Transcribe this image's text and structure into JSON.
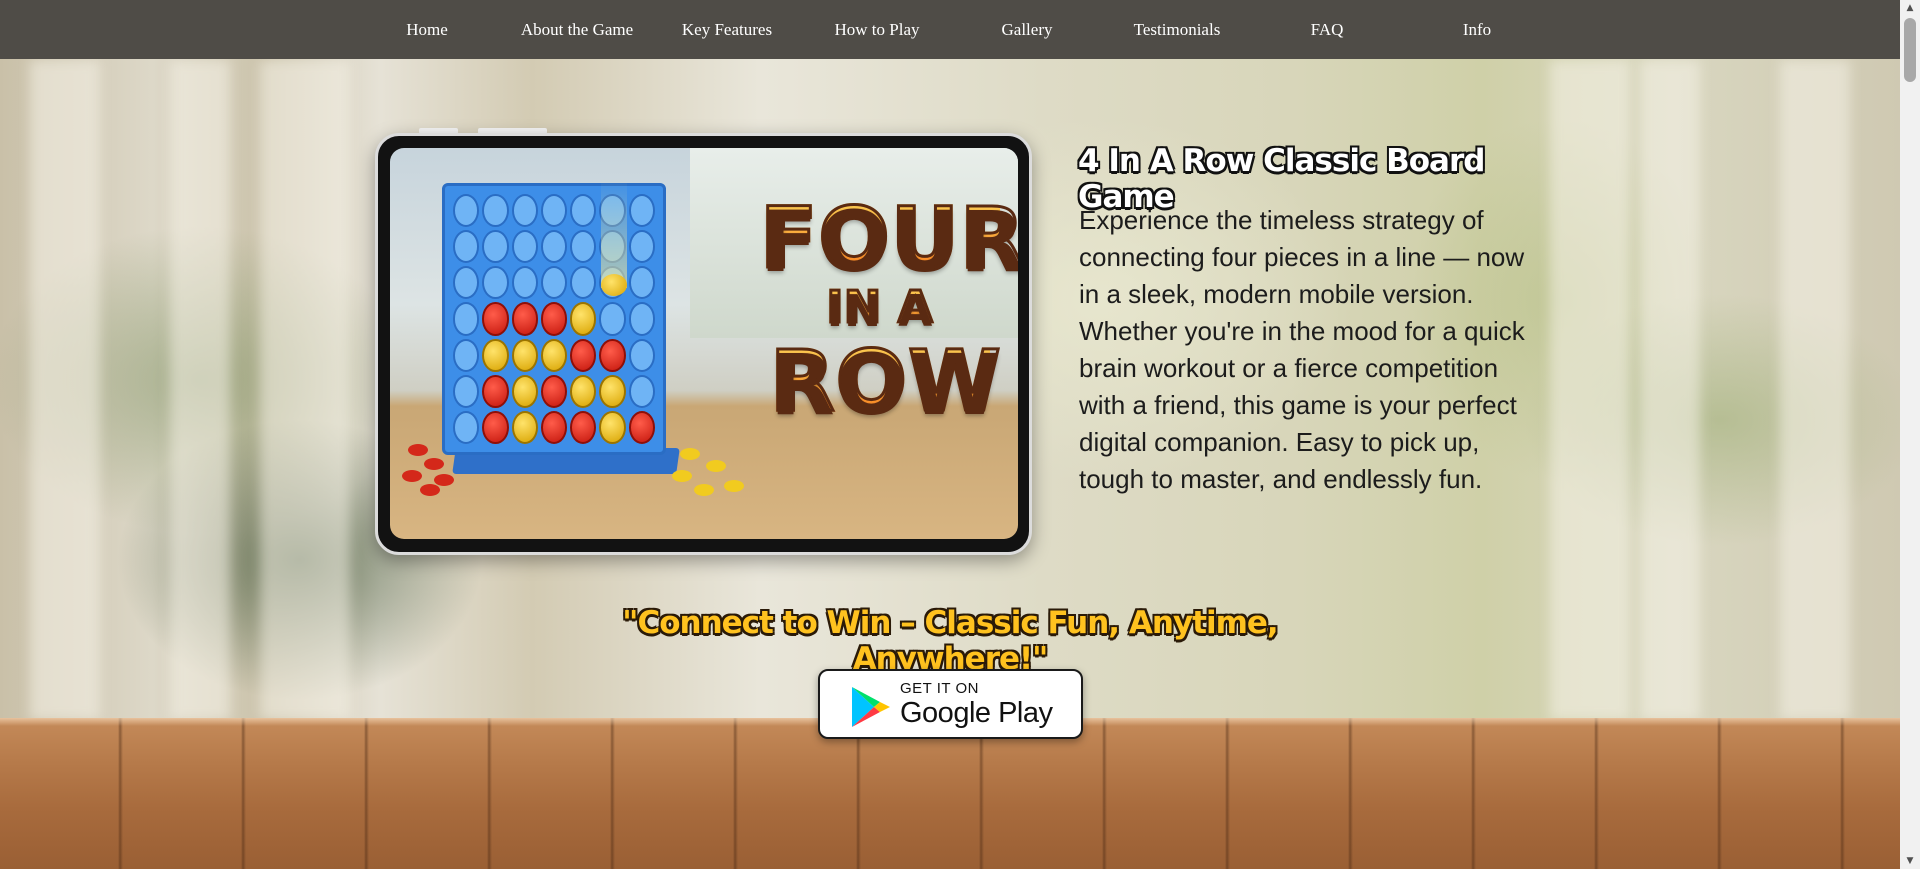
{
  "nav": {
    "items": [
      {
        "label": "Home"
      },
      {
        "label": "About the Game"
      },
      {
        "label": "Key Features"
      },
      {
        "label": "How to Play"
      },
      {
        "label": "Gallery"
      },
      {
        "label": "Testimonials"
      },
      {
        "label": "FAQ"
      },
      {
        "label": "Info"
      }
    ]
  },
  "hero": {
    "image_logo": {
      "line1": "FOUR",
      "line2": "IN A",
      "line3": "ROW"
    },
    "title": "4 In A Row Classic Board Game",
    "description": "Experience the timeless strategy of connecting four pieces in a line — now in a sleek, modern mobile version. Whether you're in the mood for a quick brain workout or a fierce competition with a friend, this game is your perfect digital companion. Easy to pick up, tough to master, and endlessly fun.",
    "tagline": "\"Connect to Win – Classic Fun, Anytime, Anywhere!\""
  },
  "store_badge": {
    "small_text": "GET IT ON",
    "big_text": "Google Play",
    "icon": "google-play-icon"
  },
  "colors": {
    "nav_bg": "#4f4c47",
    "tagline": "#ffc21f",
    "board_blue": "#3d8ee8"
  }
}
